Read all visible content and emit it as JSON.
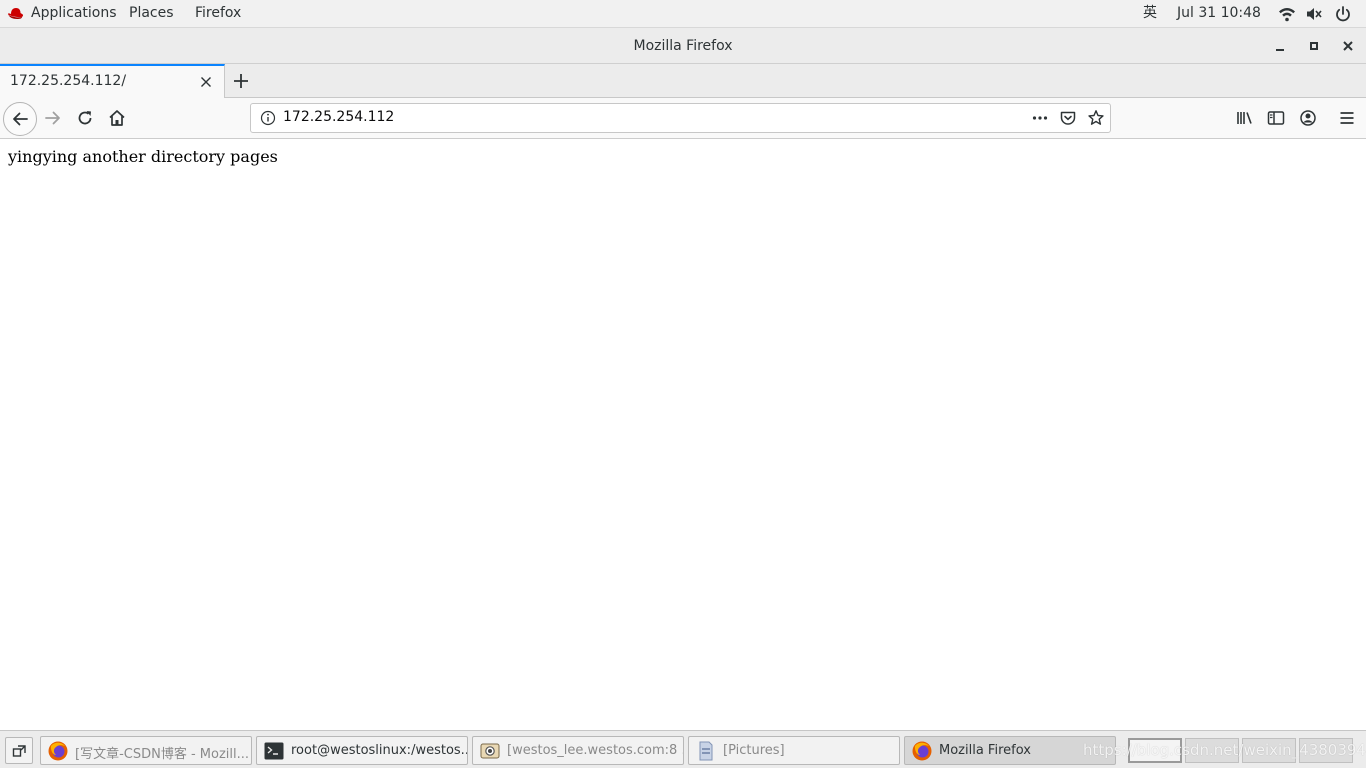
{
  "topbar": {
    "applications": "Applications",
    "places": "Places",
    "app_menu": "Firefox",
    "input_method": "英",
    "clock": "Jul 31  10:48"
  },
  "window": {
    "title": "Mozilla Firefox"
  },
  "tabs": [
    {
      "label": "172.25.254.112/",
      "active": true
    }
  ],
  "urlbar": {
    "value": "172.25.254.112"
  },
  "page": {
    "text": "yingying another directory pages"
  },
  "taskbar": {
    "tasks": [
      {
        "label": "[写文章-CSDN博客 - Mozill...",
        "icon": "firefox-icon",
        "active": false
      },
      {
        "label": "root@westoslinux:/westos...",
        "icon": "terminal-icon",
        "active": false
      },
      {
        "label": "[westos_lee.westos.com:8 ...",
        "icon": "screenshot-tool-icon",
        "active": false
      },
      {
        "label": "[Pictures]",
        "icon": "file-manager-icon",
        "active": false
      },
      {
        "label": "Mozilla Firefox",
        "icon": "firefox-icon",
        "active": true
      }
    ],
    "watermark": "https://blog.csdn.net/weixin_43803940"
  },
  "colors": {
    "accent": "#0a84ff",
    "redhat": "#cc0000"
  }
}
